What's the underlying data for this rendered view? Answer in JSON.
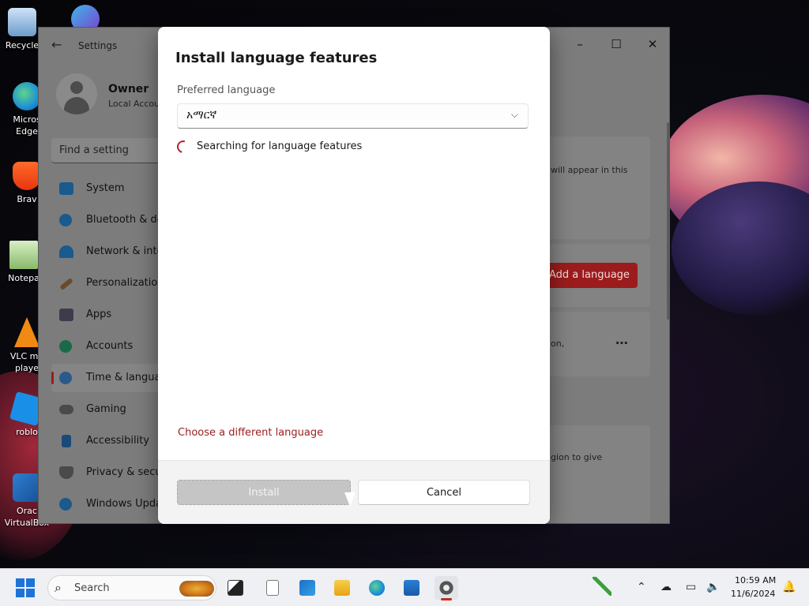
{
  "desktop": {
    "icons": [
      {
        "label": "Recycle"
      },
      {
        "label": "Micros\nEdge"
      },
      {
        "label": "Brav"
      },
      {
        "label": "Notepa"
      },
      {
        "label": "VLC me\nplaye"
      },
      {
        "label": "roblo"
      },
      {
        "label": "Orac\nVirtualBox"
      }
    ]
  },
  "settings": {
    "app_title": "Settings",
    "user": {
      "name": "Owner",
      "account_type": "Local Accou"
    },
    "search_placeholder": "Find a setting",
    "nav": [
      {
        "label": "System"
      },
      {
        "label": "Bluetooth & de"
      },
      {
        "label": "Network & inte"
      },
      {
        "label": "Personalization"
      },
      {
        "label": "Apps"
      },
      {
        "label": "Accounts"
      },
      {
        "label": "Time & langua"
      },
      {
        "label": "Gaming"
      },
      {
        "label": "Accessibility"
      },
      {
        "label": "Privacy & secu"
      },
      {
        "label": "Windows Upda"
      }
    ],
    "content": {
      "card1_text": "will appear in this",
      "add_language_label": "Add a language",
      "card2_text": "on,",
      "card3_text": "gion to give"
    }
  },
  "dialog": {
    "title": "Install language features",
    "preferred_label": "Preferred language",
    "selected_language": "አማርኛ",
    "status_text": "Searching for language features",
    "different_language_link": "Choose a different language",
    "install_label": "Install",
    "cancel_label": "Cancel"
  },
  "taskbar": {
    "search_label": "Search",
    "time": "10:59 AM",
    "date": "11/6/2024"
  },
  "colors": {
    "accent": "#9b1c1c",
    "windows_blue": "#1f73d8"
  }
}
